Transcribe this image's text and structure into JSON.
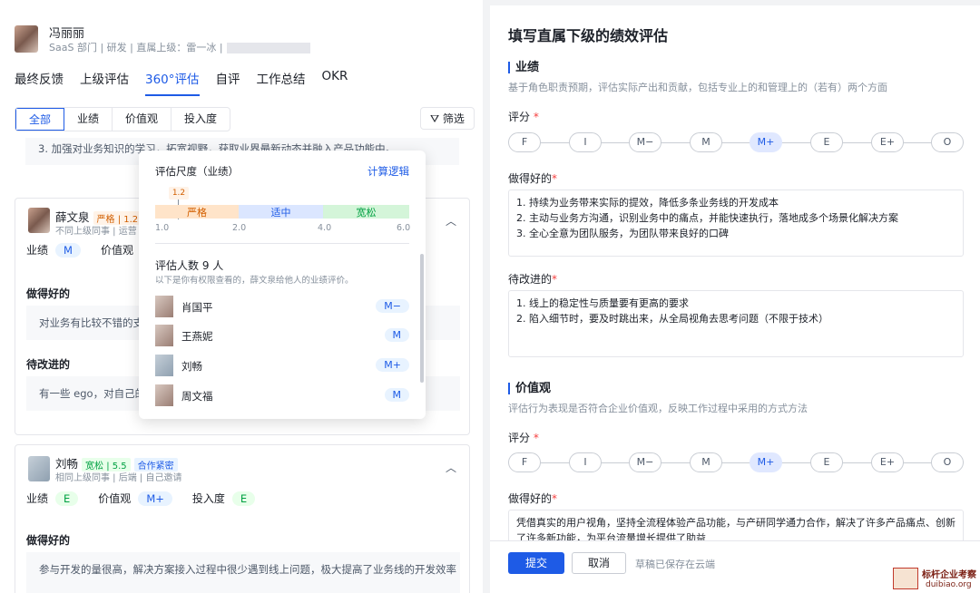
{
  "header": {
    "name": "冯丽丽",
    "meta": "SaaS 部门 | 研发 | 直属上级：雷一冰 |"
  },
  "tabs": [
    "最终反馈",
    "上级评估",
    "360°评估",
    "自评",
    "工作总结",
    "OKR"
  ],
  "filters": [
    "全部",
    "业绩",
    "价值观",
    "投入度"
  ],
  "filter_btn": "筛选",
  "prev_text": "3. 加强对业务知识的学习，拓宽视野，获取业界最新动态并融入产品功能中。",
  "card1": {
    "name": "薛文泉",
    "tag": "严格 | 1.2",
    "sub": "不同上级同事 | 运营 | 三",
    "scores": {
      "业绩": "M",
      "价值观": "M"
    },
    "good_title": "做得好的",
    "good": "对业务有比较不错的支持",
    "improve_title": "待改进的",
    "improve": "有一些 ego，对自己的想法"
  },
  "card2": {
    "name": "刘畅",
    "tag1": "宽松 | 5.5",
    "tag2": "合作紧密",
    "sub": "相同上级同事 | 后端 | 自己邀请",
    "scores": [
      {
        "k": "业绩",
        "v": "E"
      },
      {
        "k": "价值观",
        "v": "M+"
      },
      {
        "k": "投入度",
        "v": "E"
      }
    ],
    "good_title": "做得好的",
    "good": "参与开发的量很高，解决方案接入过程中很少遇到线上问题，极大提高了业务线的开发效率"
  },
  "popup": {
    "title": "评估尺度（业绩）",
    "link": "计算逻辑",
    "marker": "1.2",
    "zones": [
      "严格",
      "适中",
      "宽松"
    ],
    "ticks": [
      "1.0",
      "2.0",
      "4.0",
      "6.0"
    ],
    "count": "评估人数 9 人",
    "note": "以下是你有权限查看的，薛文泉给他人的业绩评价。",
    "people": [
      {
        "name": "肖国平",
        "score": "M−"
      },
      {
        "name": "王燕妮",
        "score": "M"
      },
      {
        "name": "刘畅",
        "score": "M+"
      },
      {
        "name": "周文福",
        "score": "M"
      }
    ]
  },
  "right": {
    "title": "填写直属下级的绩效评估",
    "perf": {
      "title": "业绩",
      "desc": "基于角色职责预期，评估实际产出和贡献，包括专业上的和管理上的（若有）两个方面",
      "rating_label": "评分",
      "good_label": "做得好的",
      "good": [
        "1. 持续为业务带来实际的提效，降低多条业务线的开发成本",
        "2. 主动与业务方沟通，识别业务中的痛点，并能快速执行，落地成多个场景化解决方案",
        "3. 全心全意为团队服务，为团队带来良好的口碑"
      ],
      "improve_label": "待改进的",
      "improve": [
        "1. 线上的稳定性与质量要有更高的要求",
        "2. 陷入细节时，要及时跳出来，从全局视角去思考问题（不限于技术）"
      ]
    },
    "values": {
      "title": "价值观",
      "desc": "评估行为表现是否符合企业价值观，反映工作过程中采用的方式方法",
      "rating_label": "评分",
      "good_label": "做得好的",
      "good": "凭借真实的用户视角，坚持全流程体验产品功能，与产研同学通力合作，解决了许多产品痛点、创新了许多新功能，为平台流量增长提供了助益"
    },
    "rating_options": [
      "F",
      "I",
      "M−",
      "M",
      "M+",
      "E",
      "E+",
      "O"
    ],
    "selected": "M+",
    "req": "*"
  },
  "footer": {
    "submit": "提交",
    "cancel": "取消",
    "draft": "草稿已保存在云端"
  },
  "watermark": {
    "t1": "标杆企业考察",
    "t2": "duibiao.org"
  }
}
